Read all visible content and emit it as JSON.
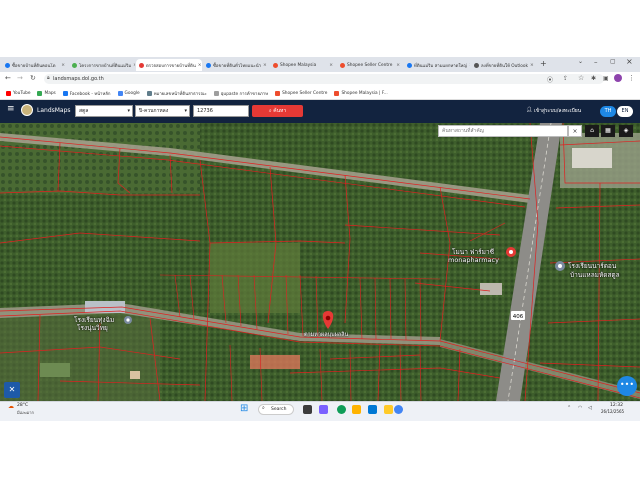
{
  "browser": {
    "tabs": [
      {
        "label": "ซื้อขายบ้านที่ดินคอนโด",
        "color": "#1877f2"
      },
      {
        "label": "โครงการขายบ้านที่ดินแม่ริม",
        "color": "#4caf50"
      },
      {
        "label": "ตรวจสอบการขายบ้านที่ดิน",
        "color": "#e53935",
        "active": true
      },
      {
        "label": "ซื้อขายที่ดินทั่วไทยแนะนำ",
        "color": "#1877f2"
      },
      {
        "label": "Shopee Malaysia",
        "color": "#ee4d2d"
      },
      {
        "label": "Shopee Seller Centre",
        "color": "#ee4d2d"
      },
      {
        "label": "ที่ดินแม่ริม สามแยกหาดใหญ่",
        "color": "#1877f2"
      },
      {
        "label": "ลงที่ขายที่ดินให้ Outlook",
        "color": "#555555"
      }
    ],
    "url": "landsmaps.dol.go.th",
    "bookmarks": [
      {
        "label": "YouTube",
        "color": "#ff0000"
      },
      {
        "label": "Maps",
        "color": "#34a853"
      },
      {
        "label": "Facebook - หน้าหลัก",
        "color": "#1877f2"
      },
      {
        "label": "Google",
        "color": "#4285f4"
      },
      {
        "label": "หมายเลขหน้าที่ดินสาธารณะ",
        "color": "#607d8b"
      },
      {
        "label": "qupaste การค้าขายภาษ",
        "color": "#9e9e9e"
      },
      {
        "label": "Shopee Seller Centre",
        "color": "#ee4d2d"
      },
      {
        "label": "Shopee Malaysia | F...",
        "color": "#ee4d2d"
      }
    ]
  },
  "app": {
    "logo": "LandsMaps",
    "province": "สตูล",
    "district": "ปิ-ควนกาหลง",
    "parcel_number": "12736",
    "search_button": "ค้นหา",
    "login": "เข้าสู่ระบบ/ลงทะเบียน",
    "lang_th": "TH",
    "lang_en": "EN",
    "map_search_placeholder": "ค้นหาสถานที่สำคัญ",
    "labels": {
      "pharmacy_th": "โมนา ฟาร์มาซี",
      "pharmacy_en": "monapharmacy",
      "school_right_1": "โรงเรียนนาร์ดอน",
      "school_right_2": "บ้านแหลมหัดสตูล",
      "school_left_1": "โรงเรียนทุ่งฉิม",
      "school_left_2": "โรงนุ่นวิทยุ",
      "pin_label": "ตามหาผลบุบผลลิน",
      "road_number": "406"
    },
    "colors": {
      "header": "#12233f",
      "search_button": "#e53935",
      "parcel_line": "#e02020",
      "fab": "#1e88e5"
    }
  },
  "taskbar": {
    "weather_temp": "28°C",
    "weather_desc": "มีเมฆมาก",
    "search": "Search",
    "time": "12:32",
    "date": "26/12/2565"
  }
}
